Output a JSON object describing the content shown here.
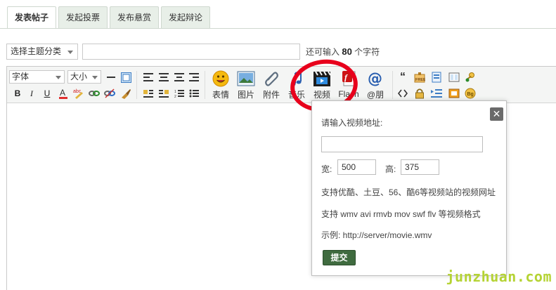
{
  "tabs": [
    {
      "label": "发表帖子",
      "active": true
    },
    {
      "label": "发起投票",
      "active": false
    },
    {
      "label": "发布悬赏",
      "active": false
    },
    {
      "label": "发起辩论",
      "active": false
    }
  ],
  "subject": {
    "category_value": "选择主题分类",
    "counter_prefix": "还可输入",
    "counter_value": "80",
    "counter_suffix": "个字符"
  },
  "toolbar": {
    "font_select": "字体",
    "size_select": "大小",
    "big_buttons": {
      "emoji": "表情",
      "image": "图片",
      "attachment": "附件",
      "music": "音乐",
      "video": "视频",
      "flash": "Flash",
      "mention": "@朋"
    }
  },
  "video_popup": {
    "url_label": "请输入视频地址:",
    "url_value": "",
    "width_label": "宽:",
    "width_value": "500",
    "height_label": "高:",
    "height_value": "375",
    "support_sites": "支持优酷、土豆、56、酷6等视频站的视频网址",
    "support_formats": "支持 wmv avi rmvb mov swf flv 等视频格式",
    "example": "示例: http://server/movie.wmv",
    "submit_label": "提交",
    "close_label": "✕"
  },
  "watermark": "junzhuan.com",
  "colors": {
    "accent_green": "#3f6b3f",
    "annotation_red": "#e8001c",
    "watermark": "#b5d334"
  }
}
